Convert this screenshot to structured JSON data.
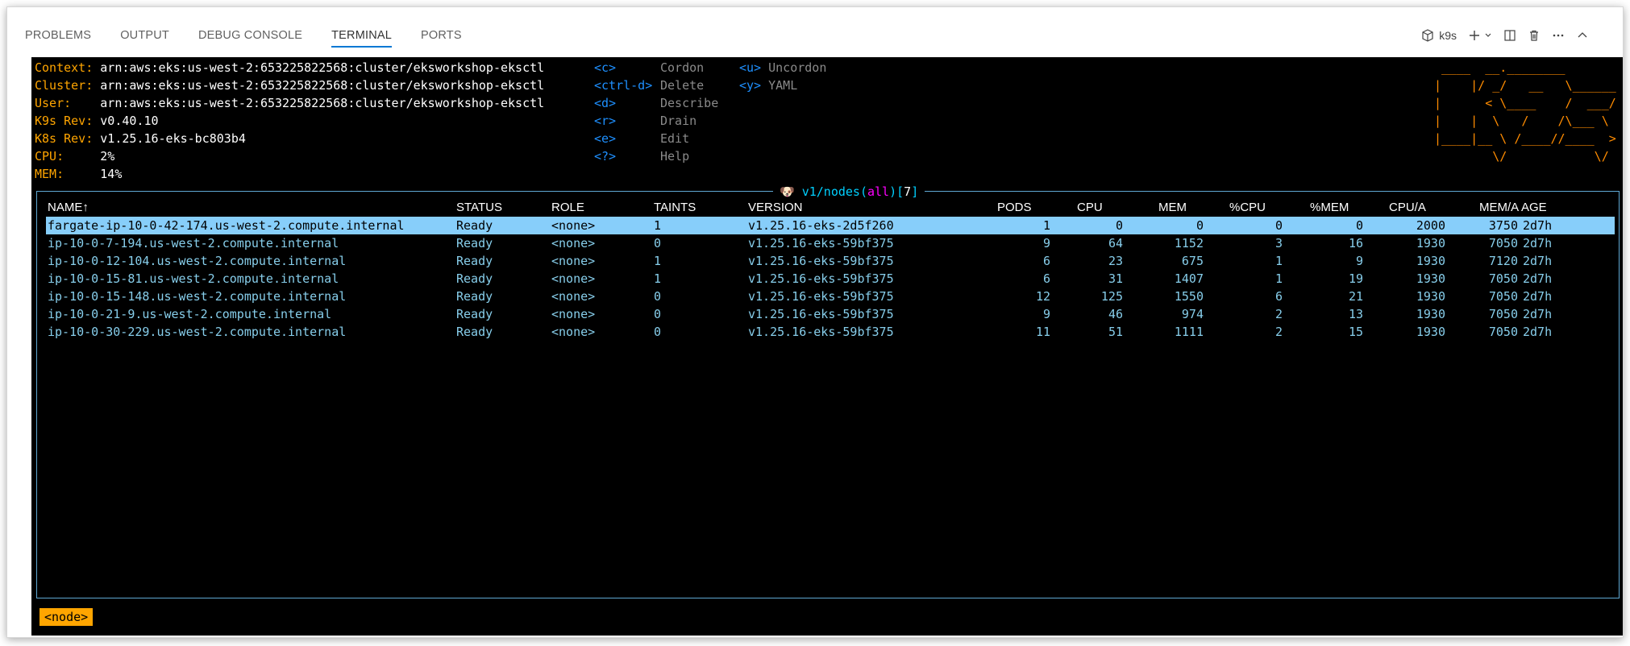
{
  "panel": {
    "tabs": [
      "PROBLEMS",
      "OUTPUT",
      "DEBUG CONSOLE",
      "TERMINAL",
      "PORTS"
    ],
    "active_tab": "TERMINAL",
    "terminal_name": "k9s"
  },
  "info": {
    "context_label": "Context:",
    "context": "arn:aws:eks:us-west-2:653225822568:cluster/eksworkshop-eksctl",
    "cluster_label": "Cluster:",
    "cluster": "arn:aws:eks:us-west-2:653225822568:cluster/eksworkshop-eksctl",
    "user_label": "User:",
    "user": "arn:aws:eks:us-west-2:653225822568:cluster/eksworkshop-eksctl",
    "k9s_rev_label": "K9s Rev:",
    "k9s_rev": "v0.40.10",
    "k8s_rev_label": "K8s Rev:",
    "k8s_rev": "v1.25.16-eks-bc803b4",
    "cpu_label": "CPU:",
    "cpu": "2%",
    "mem_label": "MEM:",
    "mem": "14%"
  },
  "shortcuts": [
    {
      "key": "<c>",
      "desc": "Cordon"
    },
    {
      "key": "<ctrl-d>",
      "desc": "Delete"
    },
    {
      "key": "<d>",
      "desc": "Describe"
    },
    {
      "key": "<r>",
      "desc": "Drain"
    },
    {
      "key": "<e>",
      "desc": "Edit"
    },
    {
      "key": "<?>",
      "desc": "Help"
    },
    {
      "key": "<u>",
      "desc": "Uncordon"
    },
    {
      "key": "<y>",
      "desc": "YAML"
    }
  ],
  "logo": {
    "lines": [
      " ____  __.________        ",
      "|    |/ _/   __   \\______ ",
      "|      < \\____    /  ___/ ",
      "|    |  \\   /    /\\___ \\  ",
      "|____|__ \\ /____//____  > ",
      "        \\/            \\/  "
    ]
  },
  "table": {
    "title_icon": "🐶",
    "title_resource": "v1/nodes",
    "title_ns": "all",
    "title_count": "7",
    "headers": {
      "name": "NAME↑",
      "status": "STATUS",
      "role": "ROLE",
      "taints": "TAINTS",
      "version": "VERSION",
      "pods": "PODS",
      "cpu": "CPU",
      "mem": "MEM",
      "pcpu": "%CPU",
      "pmem": "%MEM",
      "cpua": "CPU/A",
      "mema": "MEM/A",
      "age": "AGE"
    },
    "rows": [
      {
        "name": "fargate-ip-10-0-42-174.us-west-2.compute.internal",
        "status": "Ready",
        "role": "<none>",
        "taints": "1",
        "version": "v1.25.16-eks-2d5f260",
        "pods": "1",
        "cpu": "0",
        "mem": "0",
        "pcpu": "0",
        "pmem": "0",
        "cpua": "2000",
        "mema": "3750",
        "age": "2d7h"
      },
      {
        "name": "ip-10-0-7-194.us-west-2.compute.internal",
        "status": "Ready",
        "role": "<none>",
        "taints": "0",
        "version": "v1.25.16-eks-59bf375",
        "pods": "9",
        "cpu": "64",
        "mem": "1152",
        "pcpu": "3",
        "pmem": "16",
        "cpua": "1930",
        "mema": "7050",
        "age": "2d7h"
      },
      {
        "name": "ip-10-0-12-104.us-west-2.compute.internal",
        "status": "Ready",
        "role": "<none>",
        "taints": "1",
        "version": "v1.25.16-eks-59bf375",
        "pods": "6",
        "cpu": "23",
        "mem": "675",
        "pcpu": "1",
        "pmem": "9",
        "cpua": "1930",
        "mema": "7120",
        "age": "2d7h"
      },
      {
        "name": "ip-10-0-15-81.us-west-2.compute.internal",
        "status": "Ready",
        "role": "<none>",
        "taints": "1",
        "version": "v1.25.16-eks-59bf375",
        "pods": "6",
        "cpu": "31",
        "mem": "1407",
        "pcpu": "1",
        "pmem": "19",
        "cpua": "1930",
        "mema": "7050",
        "age": "2d7h"
      },
      {
        "name": "ip-10-0-15-148.us-west-2.compute.internal",
        "status": "Ready",
        "role": "<none>",
        "taints": "0",
        "version": "v1.25.16-eks-59bf375",
        "pods": "12",
        "cpu": "125",
        "mem": "1550",
        "pcpu": "6",
        "pmem": "21",
        "cpua": "1930",
        "mema": "7050",
        "age": "2d7h"
      },
      {
        "name": "ip-10-0-21-9.us-west-2.compute.internal",
        "status": "Ready",
        "role": "<none>",
        "taints": "0",
        "version": "v1.25.16-eks-59bf375",
        "pods": "9",
        "cpu": "46",
        "mem": "974",
        "pcpu": "2",
        "pmem": "13",
        "cpua": "1930",
        "mema": "7050",
        "age": "2d7h"
      },
      {
        "name": "ip-10-0-30-229.us-west-2.compute.internal",
        "status": "Ready",
        "role": "<none>",
        "taints": "0",
        "version": "v1.25.16-eks-59bf375",
        "pods": "11",
        "cpu": "51",
        "mem": "1111",
        "pcpu": "2",
        "pmem": "15",
        "cpua": "1930",
        "mema": "7050",
        "age": "2d7h"
      }
    ],
    "selected_row": 0
  },
  "breadcrumb": "<node>",
  "colors": {
    "label": "#ffa500",
    "key": "#1e90ff",
    "row_text": "#87ceeb",
    "selection": "#87cefa",
    "border": "#5fa8d3",
    "logo": "#ff8c00"
  }
}
